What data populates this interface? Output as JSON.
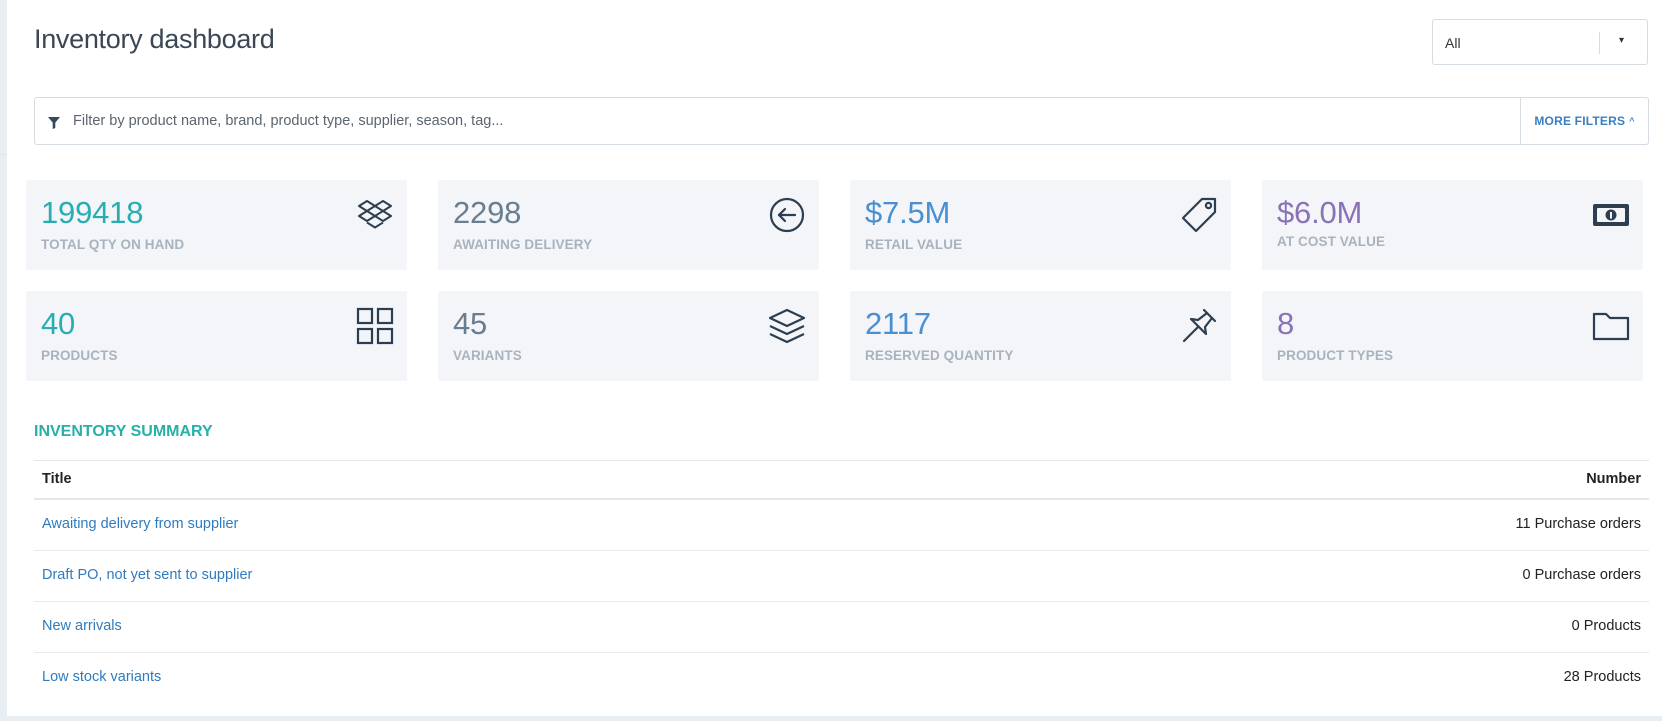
{
  "page": {
    "title": "Inventory dashboard"
  },
  "location_select": {
    "value": "All",
    "arrow": "▾"
  },
  "filter": {
    "placeholder": "Filter by product name, brand, product type, supplier, season, tag...",
    "value": "",
    "more_filters_label": "MORE FILTERS",
    "more_filters_chevron": "^"
  },
  "cards": [
    {
      "value": "199418",
      "label": "TOTAL QTY ON HAND",
      "icon": "dropbox-box-icon",
      "color": "#26aeb3"
    },
    {
      "value": "2298",
      "label": "AWAITING DELIVERY",
      "icon": "arrow-left-circle-icon",
      "color": "#6a7e92"
    },
    {
      "value": "$7.5M",
      "label": "RETAIL VALUE",
      "icon": "price-tag-icon",
      "color": "#4a8fd0"
    },
    {
      "value": "$6.0M",
      "label": "AT COST VALUE",
      "icon": "banknote-icon",
      "color": "#8a72b6"
    },
    {
      "value": "40",
      "label": "PRODUCTS",
      "icon": "grid-icon",
      "color": "#26aeb3"
    },
    {
      "value": "45",
      "label": "VARIANTS",
      "icon": "layers-icon",
      "color": "#6a7e92"
    },
    {
      "value": "2117",
      "label": "RESERVED QUANTITY",
      "icon": "pushpin-icon",
      "color": "#4a8fd0"
    },
    {
      "value": "8",
      "label": "PRODUCT TYPES",
      "icon": "folder-icon",
      "color": "#8a72b6"
    }
  ],
  "summary": {
    "title": "INVENTORY SUMMARY",
    "columns": {
      "title": "Title",
      "number": "Number"
    },
    "rows": [
      {
        "title": "Awaiting delivery from supplier",
        "number": "11 Purchase orders"
      },
      {
        "title": "Draft PO, not yet sent to supplier",
        "number": "0 Purchase orders"
      },
      {
        "title": "New arrivals",
        "number": "0 Products"
      },
      {
        "title": "Low stock variants",
        "number": "28 Products"
      }
    ]
  }
}
